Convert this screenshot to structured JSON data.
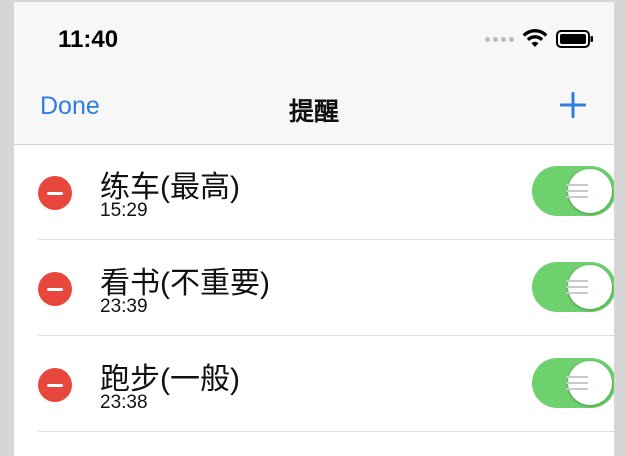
{
  "status_bar": {
    "time": "11:40"
  },
  "nav": {
    "done_label": "Done",
    "title": "提醒"
  },
  "colors": {
    "accent": "#2f7de1",
    "delete": "#e8473d",
    "toggle_on": "#6dd16d"
  },
  "reminders": [
    {
      "title": "练车(最高)",
      "time": "15:29",
      "enabled": true
    },
    {
      "title": "看书(不重要)",
      "time": "23:39",
      "enabled": true
    },
    {
      "title": "跑步(一般)",
      "time": "23:38",
      "enabled": true
    }
  ]
}
